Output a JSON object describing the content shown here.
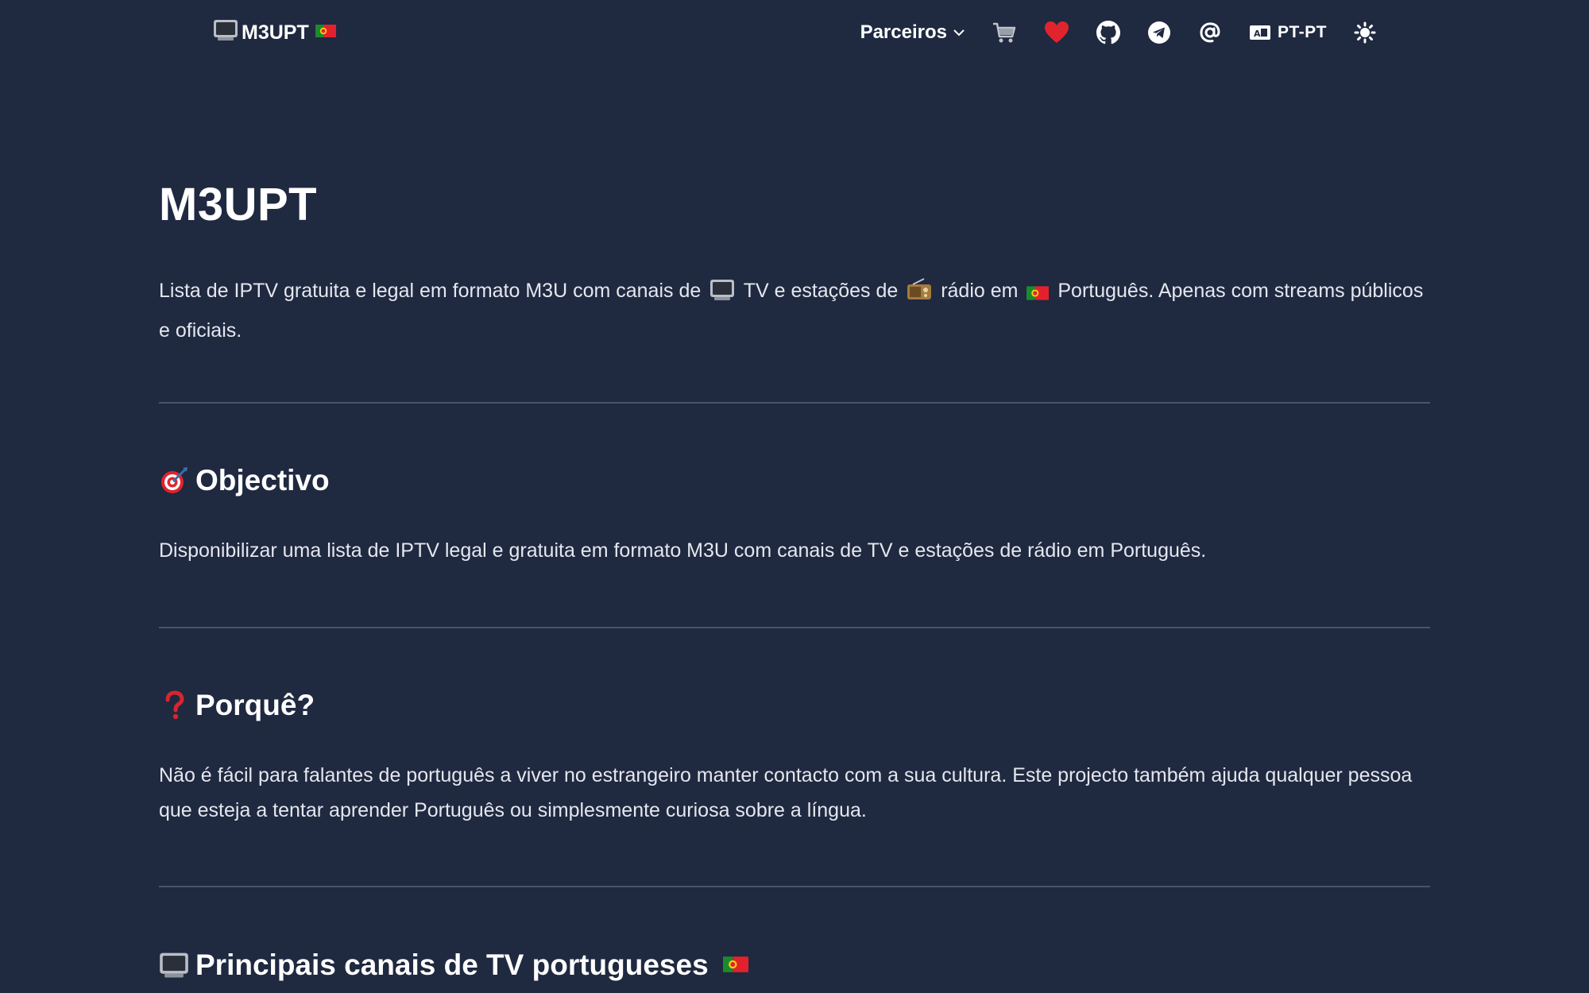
{
  "header": {
    "brand_label": "M3UPT",
    "nav": {
      "partners_label": "Parceiros",
      "language_label": "PT-PT"
    },
    "icons": [
      "tv-icon",
      "portugal-flag-icon",
      "chevron-down-icon",
      "cart-icon",
      "heart-icon",
      "github-icon",
      "telegram-icon",
      "at-sign-icon",
      "language-icon",
      "theme-toggle-icon"
    ]
  },
  "main": {
    "title": "M3UPT",
    "intro": {
      "part1": "Lista de IPTV gratuita e legal em formato M3U com canais de",
      "part2": "TV e estações de",
      "part3": "rádio em",
      "part4": "Português. Apenas com streams públicos e oficiais."
    },
    "sections": [
      {
        "title": "Objectivo",
        "icon": "target-icon",
        "text": "Disponibilizar uma lista de IPTV legal e gratuita em formato M3U com canais de TV e estações de rádio em Português."
      },
      {
        "title": "Porquê?",
        "icon": "question-mark-icon",
        "text": "Não é fácil para falantes de português a viver no estrangeiro manter contacto com a sua cultura. Este projecto também ajuda qualquer pessoa que esteja a tentar aprender Português ou simplesmente curiosa sobre a língua."
      },
      {
        "title": "Principais canais de TV portugueses",
        "icon": "tv-icon"
      }
    ]
  },
  "colors": {
    "background": "#1f2940",
    "text": "#e4e7ee",
    "heading": "#ffffff",
    "divider": "#4a5368",
    "heart": "#e0242d",
    "question": "#d7262e"
  }
}
